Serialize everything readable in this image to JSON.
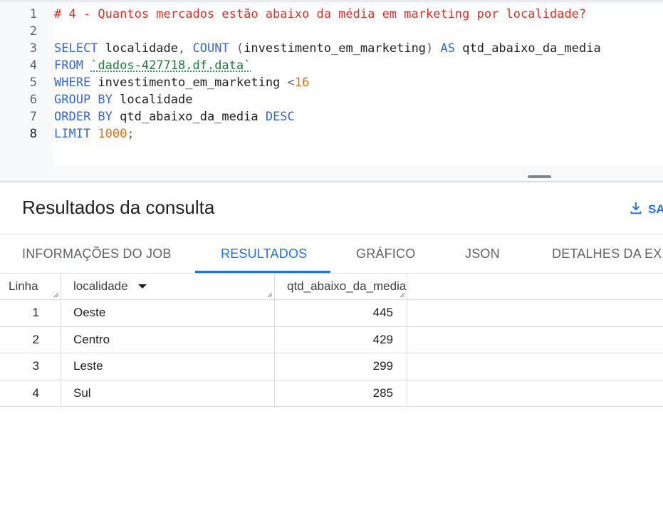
{
  "editor": {
    "lines": [
      {
        "num": "1",
        "tokens": [
          {
            "t": "cm",
            "v": "# 4 - Quantos mercados estão abaixo da média em marketing por localidade?"
          }
        ]
      },
      {
        "num": "2",
        "tokens": []
      },
      {
        "num": "3",
        "tokens": [
          {
            "t": "kw",
            "v": "SELECT"
          },
          {
            "t": "id",
            "v": " localidade"
          },
          {
            "t": "punc",
            "v": ", "
          },
          {
            "t": "fn",
            "v": "COUNT"
          },
          {
            "t": "punc",
            "v": " ("
          },
          {
            "t": "id",
            "v": "investimento_em_marketing"
          },
          {
            "t": "punc",
            "v": ") "
          },
          {
            "t": "kw",
            "v": "AS"
          },
          {
            "t": "id",
            "v": " qtd_abaixo_da_media"
          }
        ]
      },
      {
        "num": "4",
        "tokens": [
          {
            "t": "kw",
            "v": "FROM"
          },
          {
            "t": "id",
            "v": " "
          },
          {
            "t": "str",
            "v": "`dados-427718.df.data`"
          }
        ]
      },
      {
        "num": "5",
        "tokens": [
          {
            "t": "kw",
            "v": "WHERE"
          },
          {
            "t": "id",
            "v": " investimento_em_marketing "
          },
          {
            "t": "punc",
            "v": "<"
          },
          {
            "t": "num",
            "v": "16"
          }
        ]
      },
      {
        "num": "6",
        "tokens": [
          {
            "t": "kw",
            "v": "GROUP BY"
          },
          {
            "t": "id",
            "v": " localidade"
          }
        ]
      },
      {
        "num": "7",
        "tokens": [
          {
            "t": "kw",
            "v": "ORDER BY"
          },
          {
            "t": "id",
            "v": " qtd_abaixo_da_media "
          },
          {
            "t": "kw",
            "v": "DESC"
          }
        ]
      },
      {
        "num": "8",
        "tokens": [
          {
            "t": "kw",
            "v": "LIMIT"
          },
          {
            "t": "id",
            "v": " "
          },
          {
            "t": "num",
            "v": "1000"
          },
          {
            "t": "punc",
            "v": ";"
          }
        ]
      }
    ],
    "active_line": "8"
  },
  "results": {
    "title": "Resultados da consulta",
    "save_label": "SA"
  },
  "tabs": [
    {
      "label": "INFORMAÇÕES DO JOB",
      "active": false
    },
    {
      "label": "RESULTADOS",
      "active": true
    },
    {
      "label": "GRÁFICO",
      "active": false
    },
    {
      "label": "JSON",
      "active": false
    },
    {
      "label": "DETALHES DA EXI",
      "active": false
    }
  ],
  "table": {
    "headers": [
      "Linha",
      "localidade",
      "qtd_abaixo_da_media"
    ],
    "rows": [
      {
        "linha": "1",
        "localidade": "Oeste",
        "qtd": "445"
      },
      {
        "linha": "2",
        "localidade": "Centro",
        "qtd": "429"
      },
      {
        "linha": "3",
        "localidade": "Leste",
        "qtd": "299"
      },
      {
        "linha": "4",
        "localidade": "Sul",
        "qtd": "285"
      }
    ]
  },
  "colors": {
    "accent": "#1a73e8",
    "keyword": "#3367d6",
    "comment": "#d93025",
    "number": "#e8710a",
    "string": "#188038"
  }
}
